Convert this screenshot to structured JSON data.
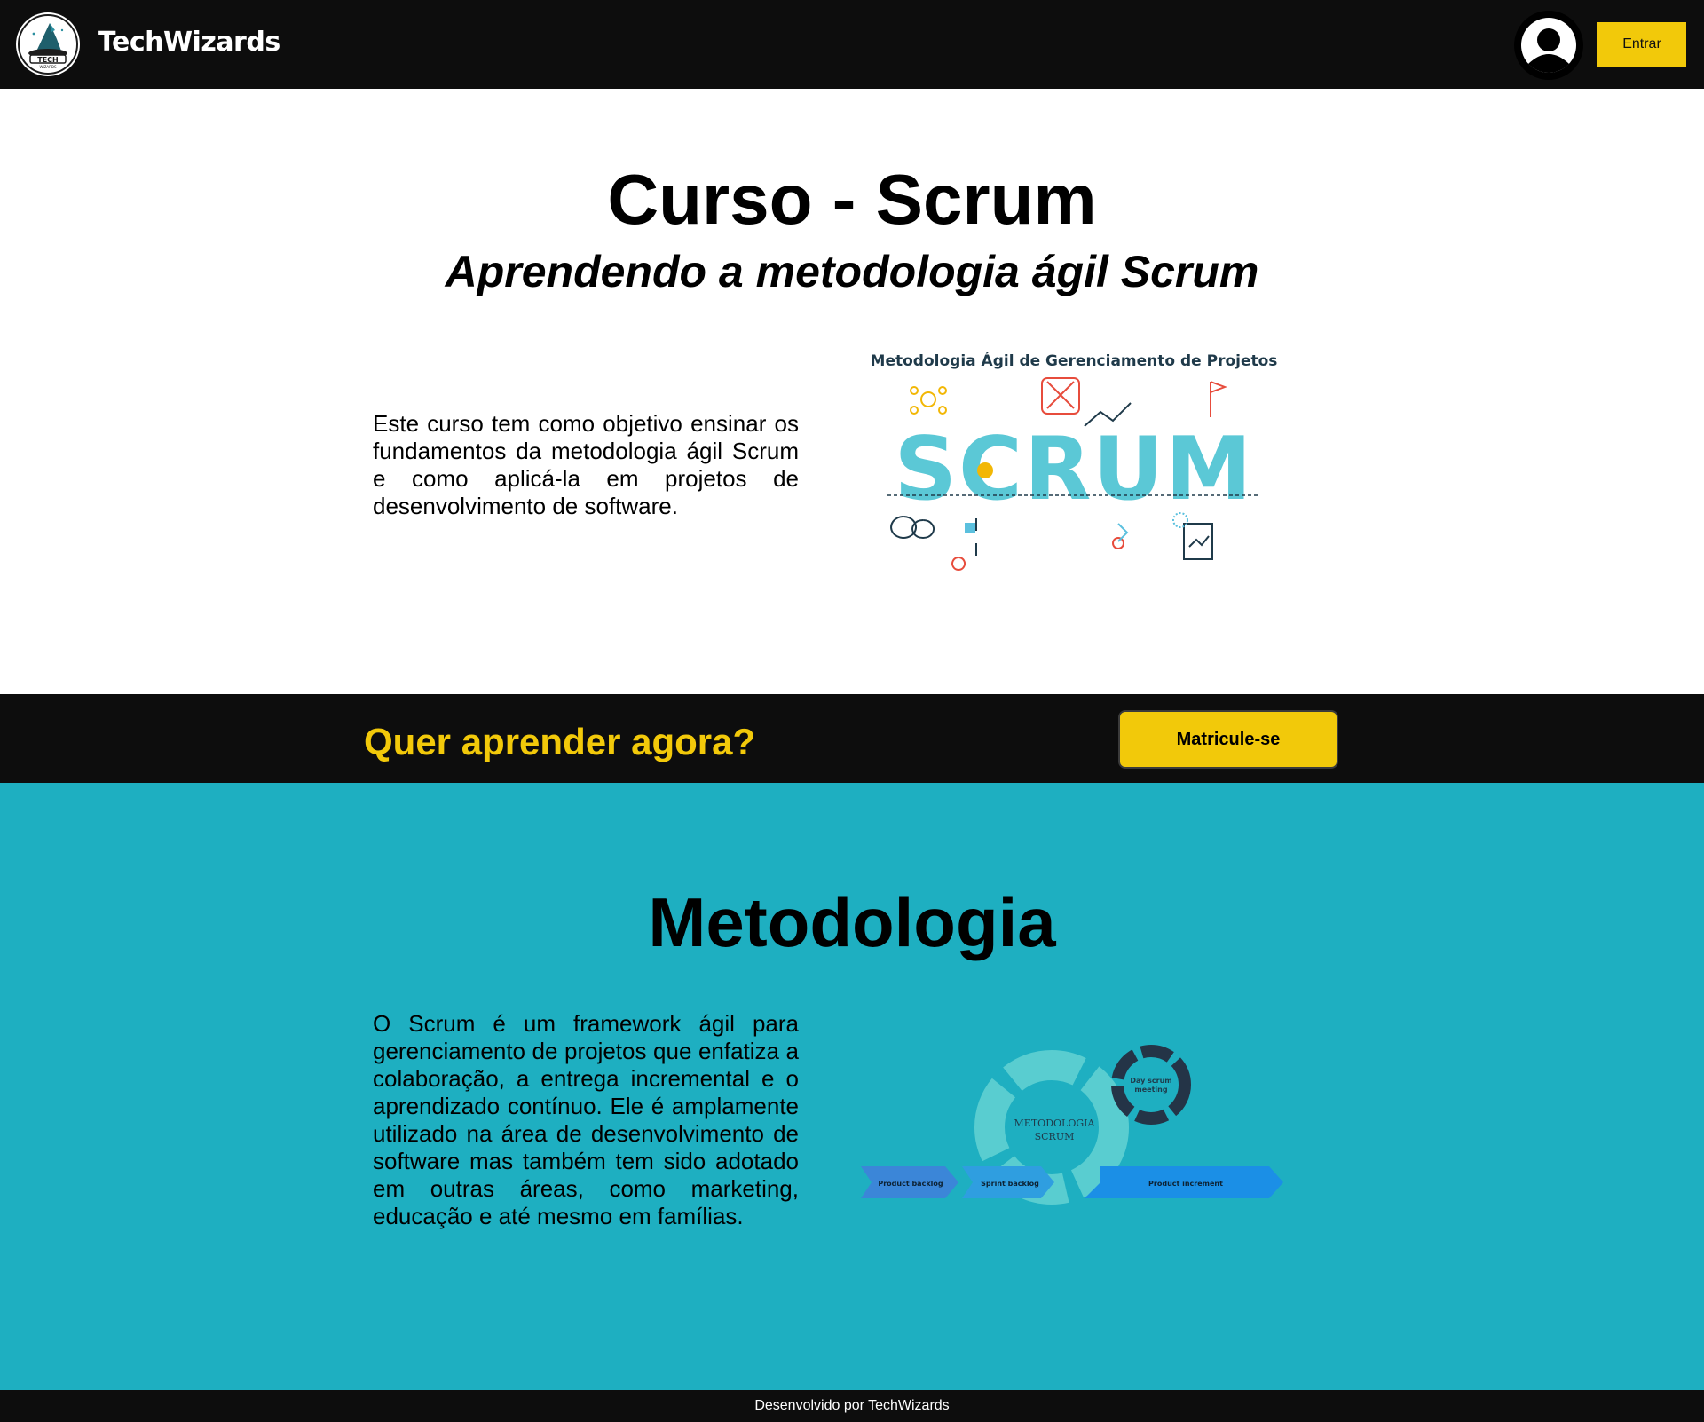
{
  "header": {
    "logo_alt": "TechWizards logo",
    "brand": "TechWizards",
    "login_label": "Entrar"
  },
  "hero": {
    "title": "Curso - Scrum",
    "subtitle": "Aprendendo a metodologia ágil Scrum",
    "intro": "Este curso tem como objetivo ensinar os fundamentos da metodologia ágil Scrum e como aplicá-la em projetos de desenvolvimento de software.",
    "image": {
      "heading": "Metodologia Ágil de Gerenciamento de Projetos",
      "word": "SCRUM"
    }
  },
  "cta": {
    "text": "Quer aprender agora?",
    "button_label": "Matricule-se"
  },
  "methodology": {
    "title": "Metodologia",
    "text": "O Scrum é um framework ágil para gerenciamento de projetos que enfatiza a colaboração, a entrega incremental e o aprendizado contínuo. Ele é amplamente utilizado na área de desenvolvimento de software mas também tem sido adotado em outras áreas, como marketing, educação e até mesmo em famílias.",
    "diagram": {
      "center_line1": "METODOLOGIA",
      "center_line2": "SCRUM",
      "day_line1": "Day scrum",
      "day_line2": "meeting",
      "arrow1": "Product backlog",
      "arrow2": "Sprint backlog",
      "arrow3": "Product increment"
    }
  },
  "footer": {
    "text": "Desenvolvido por TechWizards"
  },
  "colors": {
    "dark": "#0d0d0d",
    "yellow": "#f2c90a",
    "teal": "#1eafc1"
  }
}
